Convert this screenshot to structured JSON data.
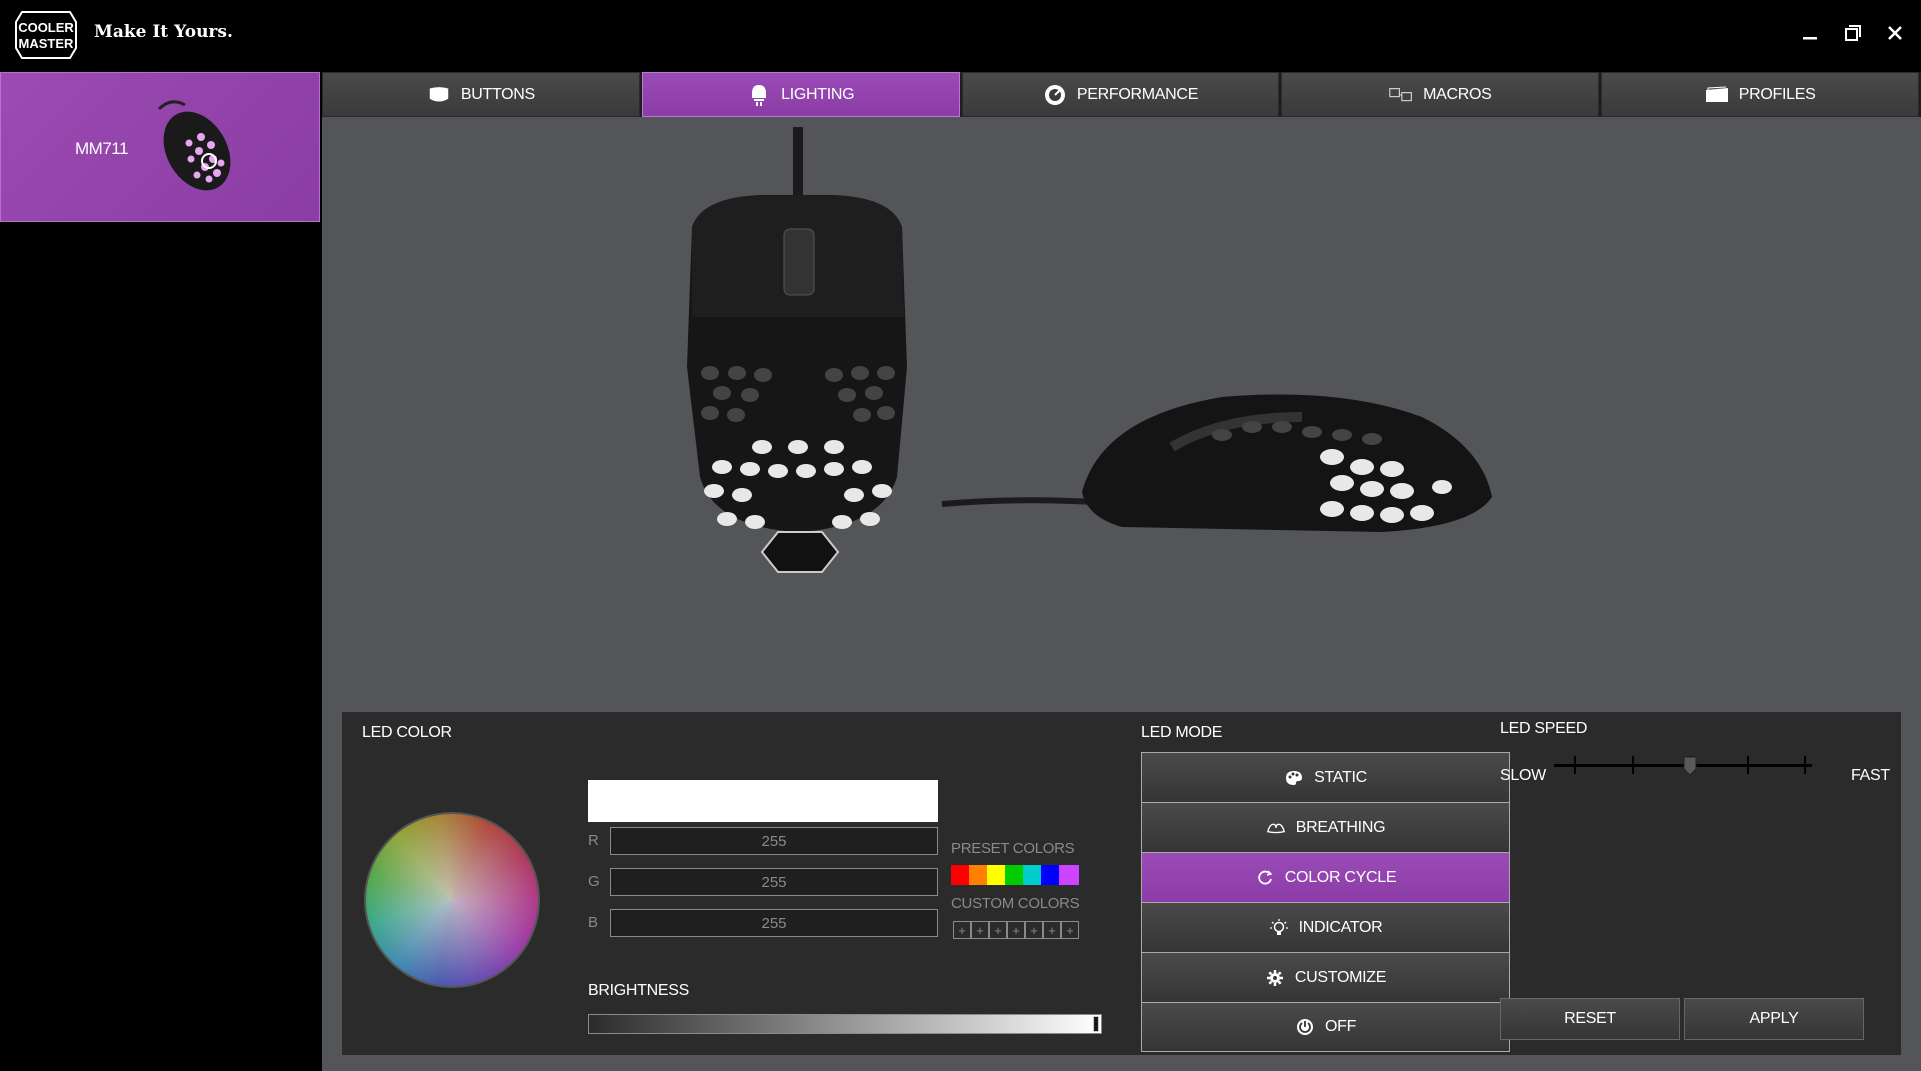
{
  "app": {
    "brand": "COOLER MASTER",
    "tagline": "Make It Yours.",
    "window_controls": [
      "minimize-icon",
      "restore-icon",
      "close-icon"
    ]
  },
  "sidebar": {
    "device_name": "MM711"
  },
  "tabs": [
    {
      "label": "BUTTONS",
      "icon": "mouse-icon",
      "active": false
    },
    {
      "label": "LIGHTING",
      "icon": "bulb-icon",
      "active": true
    },
    {
      "label": "PERFORMANCE",
      "icon": "gauge-icon",
      "active": false
    },
    {
      "label": "MACROS",
      "icon": "macro-icon",
      "active": false
    },
    {
      "label": "PROFILES",
      "icon": "folder-icon",
      "active": false
    }
  ],
  "led_color": {
    "title": "LED COLOR",
    "r_label": "R",
    "g_label": "G",
    "b_label": "B",
    "r": "255",
    "g": "255",
    "b": "255",
    "current_color": "#ffffff",
    "preset_label": "PRESET COLORS",
    "preset_colors": [
      "#ff0000",
      "#ff7f00",
      "#ffff00",
      "#00cc00",
      "#00cccc",
      "#0000ff",
      "#cc44ff"
    ],
    "custom_label": "CUSTOM COLORS",
    "custom_slot": "+",
    "custom_count": 7,
    "brightness_label": "BRIGHTNESS",
    "brightness": 1.0
  },
  "led_mode": {
    "title": "LED MODE",
    "modes": [
      {
        "label": "STATIC",
        "icon": "palette-icon",
        "active": false
      },
      {
        "label": "BREATHING",
        "icon": "breathing-icon",
        "active": false
      },
      {
        "label": "COLOR CYCLE",
        "icon": "cycle-icon",
        "active": true
      },
      {
        "label": "INDICATOR",
        "icon": "indicator-icon",
        "active": false
      },
      {
        "label": "CUSTOMIZE",
        "icon": "gear-icon",
        "active": false
      },
      {
        "label": "OFF",
        "icon": "power-icon",
        "active": false
      }
    ]
  },
  "led_speed": {
    "title": "LED SPEED",
    "slow_label": "SLOW",
    "fast_label": "FAST",
    "level": 3,
    "levels": 5
  },
  "actions": {
    "reset": "RESET",
    "apply": "APPLY"
  },
  "colors": {
    "accent": "#9a4bb5",
    "panel": "#2b2b2b",
    "background": "#545559"
  }
}
